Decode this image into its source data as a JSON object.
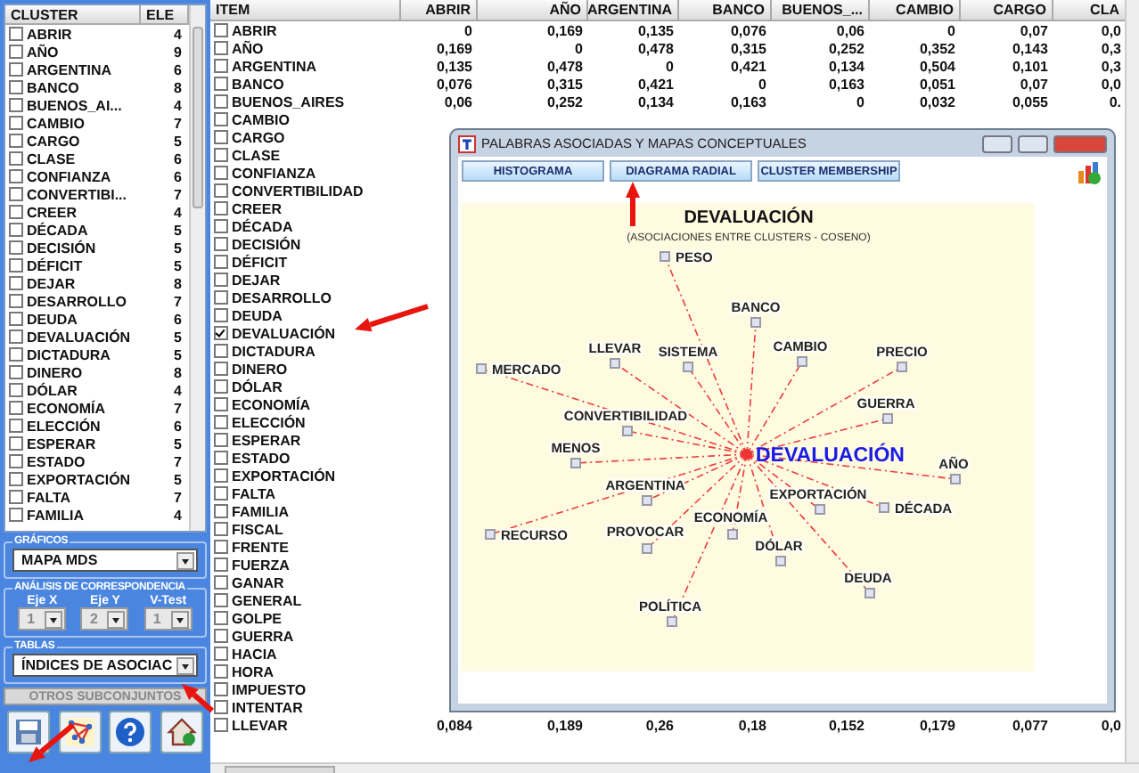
{
  "cluster_list": {
    "columns": [
      "CLUSTER",
      "ELE"
    ],
    "rows": [
      {
        "label": "ABRIR",
        "count": "4",
        "checked": false
      },
      {
        "label": "AÑO",
        "count": "9",
        "checked": false
      },
      {
        "label": "ARGENTINA",
        "count": "6",
        "checked": false
      },
      {
        "label": "BANCO",
        "count": "8",
        "checked": false
      },
      {
        "label": "BUENOS_AI...",
        "count": "4",
        "checked": false
      },
      {
        "label": "CAMBIO",
        "count": "7",
        "checked": false
      },
      {
        "label": "CARGO",
        "count": "5",
        "checked": false
      },
      {
        "label": "CLASE",
        "count": "6",
        "checked": false
      },
      {
        "label": "CONFIANZA",
        "count": "6",
        "checked": false
      },
      {
        "label": "CONVERTIBI...",
        "count": "7",
        "checked": false
      },
      {
        "label": "CREER",
        "count": "4",
        "checked": false
      },
      {
        "label": "DÉCADA",
        "count": "5",
        "checked": false
      },
      {
        "label": "DECISIÓN",
        "count": "5",
        "checked": false
      },
      {
        "label": "DÉFICIT",
        "count": "5",
        "checked": false
      },
      {
        "label": "DEJAR",
        "count": "8",
        "checked": false
      },
      {
        "label": "DESARROLLO",
        "count": "7",
        "checked": false
      },
      {
        "label": "DEUDA",
        "count": "6",
        "checked": false
      },
      {
        "label": "DEVALUACIÓN",
        "count": "5",
        "checked": false
      },
      {
        "label": "DICTADURA",
        "count": "5",
        "checked": false
      },
      {
        "label": "DINERO",
        "count": "8",
        "checked": false
      },
      {
        "label": "DÓLAR",
        "count": "4",
        "checked": false
      },
      {
        "label": "ECONOMÍA",
        "count": "7",
        "checked": false
      },
      {
        "label": "ELECCIÓN",
        "count": "6",
        "checked": false
      },
      {
        "label": "ESPERAR",
        "count": "5",
        "checked": false
      },
      {
        "label": "ESTADO",
        "count": "7",
        "checked": false
      },
      {
        "label": "EXPORTACIÓN",
        "count": "5",
        "checked": false
      },
      {
        "label": "FALTA",
        "count": "7",
        "checked": false
      },
      {
        "label": "FAMILIA",
        "count": "4",
        "checked": false
      }
    ]
  },
  "graficos": {
    "title": "GRÁFICOS",
    "value": "MAPA MDS"
  },
  "correspondencia": {
    "title": "ANÁLISIS DE CORRESPONDENCIA",
    "fields": [
      {
        "label": "Eje X",
        "value": "1",
        "disabled": true
      },
      {
        "label": "Eje Y",
        "value": "2",
        "disabled": true
      },
      {
        "label": "V-Test",
        "value": "1",
        "disabled": true
      }
    ]
  },
  "tablas": {
    "title": "TABLAS",
    "value": "ÍNDICES DE ASOCIAC"
  },
  "subsets_button": {
    "label": "OTROS SUBCONJUNTOS"
  },
  "toolbar": [
    {
      "kind": "save"
    },
    {
      "kind": "network"
    },
    {
      "kind": "help"
    },
    {
      "kind": "home"
    }
  ],
  "table": {
    "columns": [
      "ITEM",
      "ABRIR",
      "AÑO",
      "ARGENTINA",
      "BANCO",
      "BUENOS_...",
      "CAMBIO",
      "CARGO",
      "CLA"
    ],
    "rows": [
      {
        "item": "ABRIR",
        "checked": false,
        "values": [
          "0",
          "0,169",
          "0,135",
          "0,076",
          "0,06",
          "0",
          "0,07",
          "0,0"
        ]
      },
      {
        "item": "AÑO",
        "checked": false,
        "values": [
          "0,169",
          "0",
          "0,478",
          "0,315",
          "0,252",
          "0,352",
          "0,143",
          "0,3"
        ]
      },
      {
        "item": "ARGENTINA",
        "checked": false,
        "values": [
          "0,135",
          "0,478",
          "0",
          "0,421",
          "0,134",
          "0,504",
          "0,101",
          "0,3"
        ]
      },
      {
        "item": "BANCO",
        "checked": false,
        "values": [
          "0,076",
          "0,315",
          "0,421",
          "0",
          "0,163",
          "0,051",
          "0,07",
          "0,0"
        ]
      },
      {
        "item": "BUENOS_AIRES",
        "checked": false,
        "values": [
          "0,06",
          "0,252",
          "0,134",
          "0,163",
          "0",
          "0,032",
          "0,055",
          "0."
        ]
      },
      {
        "item": "CAMBIO",
        "checked": false
      },
      {
        "item": "CARGO",
        "checked": false
      },
      {
        "item": "CLASE",
        "checked": false
      },
      {
        "item": "CONFIANZA",
        "checked": false
      },
      {
        "item": "CONVERTIBILIDAD",
        "checked": false
      },
      {
        "item": "CREER",
        "checked": false
      },
      {
        "item": "DÉCADA",
        "checked": false
      },
      {
        "item": "DECISIÓN",
        "checked": false
      },
      {
        "item": "DÉFICIT",
        "checked": false
      },
      {
        "item": "DEJAR",
        "checked": false
      },
      {
        "item": "DESARROLLO",
        "checked": false
      },
      {
        "item": "DEUDA",
        "checked": false
      },
      {
        "item": "DEVALUACIÓN",
        "checked": true
      },
      {
        "item": "DICTADURA",
        "checked": false
      },
      {
        "item": "DINERO",
        "checked": false
      },
      {
        "item": "DÓLAR",
        "checked": false
      },
      {
        "item": "ECONOMÍA",
        "checked": false
      },
      {
        "item": "ELECCIÓN",
        "checked": false
      },
      {
        "item": "ESPERAR",
        "checked": false
      },
      {
        "item": "ESTADO",
        "checked": false
      },
      {
        "item": "EXPORTACIÓN",
        "checked": false
      },
      {
        "item": "FALTA",
        "checked": false
      },
      {
        "item": "FAMILIA",
        "checked": false
      },
      {
        "item": "FISCAL",
        "checked": false
      },
      {
        "item": "FRENTE",
        "checked": false
      },
      {
        "item": "FUERZA",
        "checked": false
      },
      {
        "item": "GANAR",
        "checked": false
      },
      {
        "item": "GENERAL",
        "checked": false
      },
      {
        "item": "GOLPE",
        "checked": false
      },
      {
        "item": "GUERRA",
        "checked": false
      },
      {
        "item": "HACIA",
        "checked": false
      },
      {
        "item": "HORA",
        "checked": false
      },
      {
        "item": "IMPUESTO",
        "checked": false
      },
      {
        "item": "INTENTAR",
        "checked": false
      },
      {
        "item": "LLEVAR",
        "checked": false,
        "values": [
          "0,084",
          "0,189",
          "0,26",
          "0,18",
          "0,152",
          "0,179",
          "0,077",
          "0,0"
        ]
      }
    ]
  },
  "window": {
    "title": "PALABRAS ASOCIADAS Y MAPAS CONCEPTUALES",
    "buttons": [
      "HISTOGRAMA",
      "DIAGRAMA RADIAL",
      "CLUSTER MEMBERSHIP"
    ],
    "diagram": {
      "title": "DEVALUACIÓN",
      "subtitle": "(ASOCIACIONES ENTRE CLUSTERS - COSENO)",
      "center": "DEVALUACIÓN",
      "nodes": [
        {
          "label": "PESO"
        },
        {
          "label": "BANCO"
        },
        {
          "label": "LLEVAR"
        },
        {
          "label": "SISTEMA"
        },
        {
          "label": "CAMBIO"
        },
        {
          "label": "PRECIO"
        },
        {
          "label": "MERCADO"
        },
        {
          "label": "GUERRA"
        },
        {
          "label": "CONVERTIBILIDAD"
        },
        {
          "label": "MENOS"
        },
        {
          "label": "AÑO"
        },
        {
          "label": "ARGENTINA"
        },
        {
          "label": "EXPORTACIÓN"
        },
        {
          "label": "DÉCADA"
        },
        {
          "label": "RECURSO"
        },
        {
          "label": "PROVOCAR"
        },
        {
          "label": "ECONOMÍA"
        },
        {
          "label": "DÓLAR"
        },
        {
          "label": "DEUDA"
        },
        {
          "label": "POLÍTICA"
        }
      ]
    }
  }
}
